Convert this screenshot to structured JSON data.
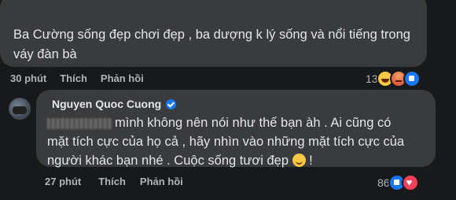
{
  "comment1": {
    "text": "Ba Cường sống đẹp chơi đẹp , ba dượng k lý sống và nổi tiếng trong váy đàn bà",
    "time": "30 phút",
    "like_label": "Thích",
    "reply_label": "Phản hồi",
    "reaction_count": "13",
    "reactions": [
      "haha",
      "angry",
      "like"
    ]
  },
  "comment2": {
    "author": "Nguyen Quoc Cuong",
    "text_line1": "mình không nên nói như thế bạn àh . Ai cũng có",
    "text_line2": "mặt tích cực của họ cả , hãy nhìn vào những mặt tích cực của",
    "text_line3": "người khác bạn nhé . Cuộc sống tươi đẹp",
    "text_end": " !",
    "time": "27 phút",
    "like_label": "Thích",
    "reply_label": "Phản hồi",
    "reaction_count": "86",
    "reactions": [
      "like",
      "love"
    ]
  },
  "colors": {
    "background": "#18191a",
    "bubble": "#3a3b3c",
    "text": "#e4e6eb",
    "secondary_text": "#b0b3b8",
    "verified": "#1877f2"
  },
  "icons": [
    "haha-reaction-icon",
    "angry-reaction-icon",
    "like-reaction-icon",
    "love-reaction-icon",
    "verified-badge-icon",
    "smile-emoji-icon"
  ]
}
